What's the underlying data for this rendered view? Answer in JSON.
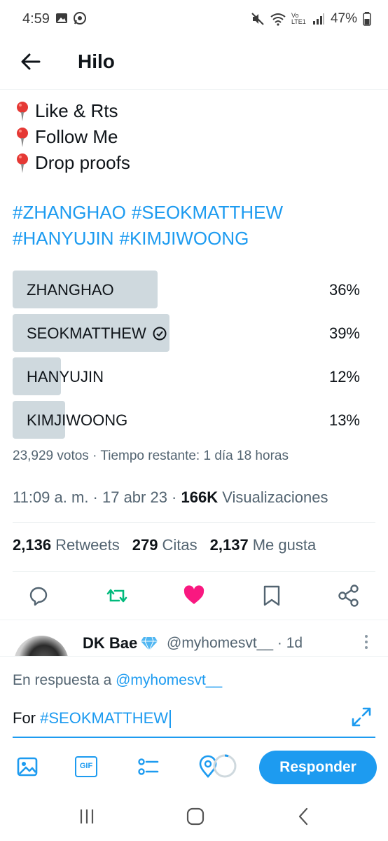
{
  "status_bar": {
    "time": "4:59",
    "battery": "47%",
    "network_label": "Vo LTE1"
  },
  "header": {
    "title": "Hilo"
  },
  "tweet": {
    "lines": [
      "Like & Rts",
      "Follow Me",
      "Drop proofs"
    ],
    "hashtags": [
      "#ZHANGHAO",
      "#SEOKMATTHEW",
      "#HANYUJIN",
      "#KIMJIWOONG"
    ]
  },
  "poll": {
    "options": [
      {
        "label": "ZHANGHAO",
        "percent": "36%",
        "fill": 36,
        "selected": false
      },
      {
        "label": "SEOKMATTHEW",
        "percent": "39%",
        "fill": 39,
        "selected": true
      },
      {
        "label": "HANYUJIN",
        "percent": "12%",
        "fill": 12,
        "selected": false
      },
      {
        "label": "KIMJIWOONG",
        "percent": "13%",
        "fill": 13,
        "selected": false
      }
    ],
    "meta": "23,929 votos · Tiempo restante: 1 día 18 horas"
  },
  "timestamp": {
    "time_date": "11:09 a. m. · 17 abr 23 ·",
    "views_count": "166K",
    "views_label": "Visualizaciones"
  },
  "stats": {
    "retweets_count": "2,136",
    "retweets_label": "Retweets",
    "quotes_count": "279",
    "quotes_label": "Citas",
    "likes_count": "2,137",
    "likes_label": "Me gusta"
  },
  "reply_preview": {
    "name": "DK Bae",
    "handle": "@myhomesvt__ · 1d"
  },
  "composer": {
    "replying_to_prefix": "En respuesta a",
    "replying_to_handle": "@myhomesvt__",
    "text_prefix": "For",
    "text_hashtag": "#SEOKMATTHEW",
    "reply_button": "Responder",
    "gif_label": "GIF"
  },
  "colors": {
    "accent": "#1d9bf0",
    "retweet_green": "#00ba7c",
    "like_pink": "#f91880",
    "poll_fill": "#cfd9de"
  }
}
